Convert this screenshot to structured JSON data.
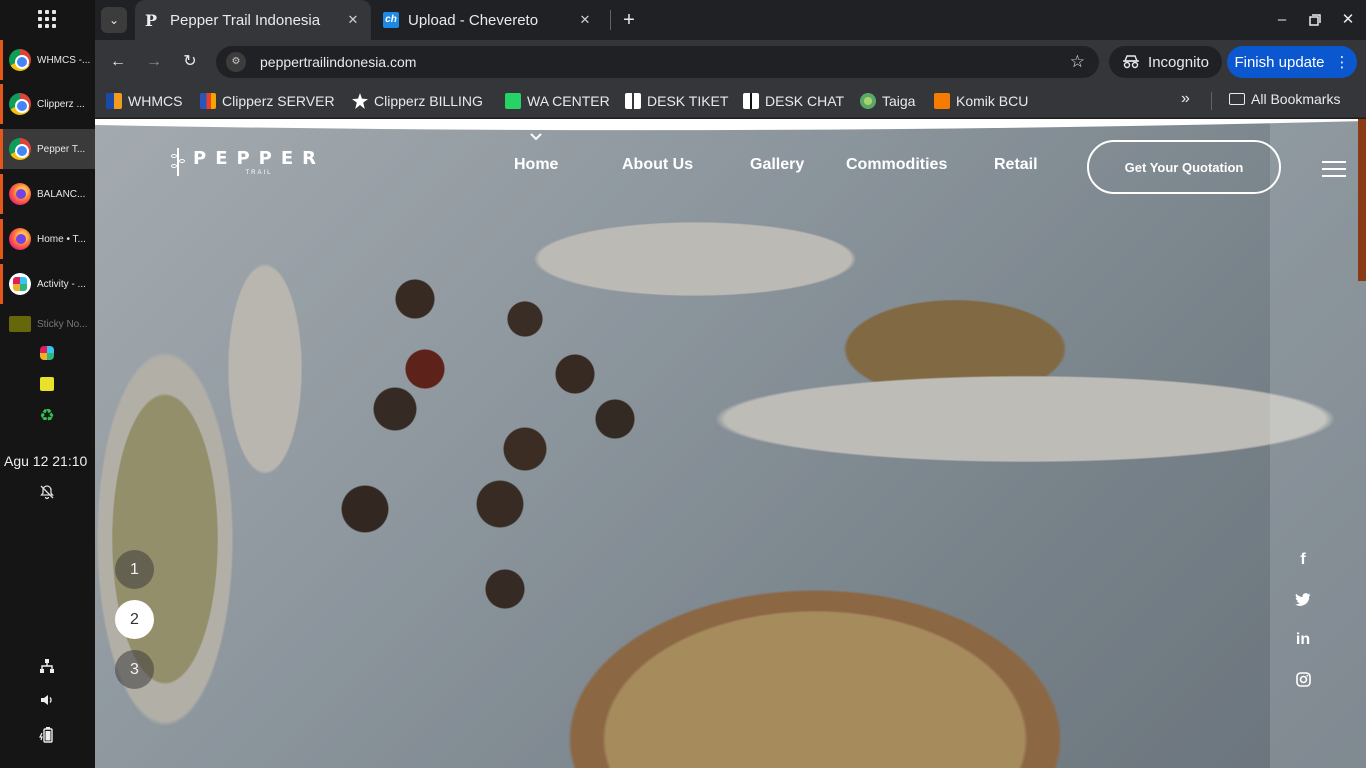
{
  "taskbar": {
    "items": [
      {
        "label": "WHMCS -...",
        "icon": "chrome-icon"
      },
      {
        "label": "Clipperz ...",
        "icon": "chrome-icon"
      },
      {
        "label": "Pepper T...",
        "icon": "chrome-icon",
        "active": true
      },
      {
        "label": "BALANC...",
        "icon": "firefox-icon"
      },
      {
        "label": "Home • T...",
        "icon": "firefox-icon"
      },
      {
        "label": "Activity - ...",
        "icon": "slack-icon"
      },
      {
        "label": "Sticky No...",
        "icon": "sticky-notes-icon"
      }
    ],
    "clock": "Agu 12  21:10"
  },
  "browser": {
    "tabs": [
      {
        "title": "Pepper Trail Indonesia",
        "favicon": "P",
        "active": true
      },
      {
        "title": "Upload - Chevereto",
        "favicon": "ch",
        "active": false
      }
    ],
    "url": "peppertrailindonesia.com",
    "incognito_label": "Incognito",
    "update_label": "Finish update",
    "bookmarks": [
      {
        "label": "WHMCS"
      },
      {
        "label": "Clipperz SERVER"
      },
      {
        "label": "Clipperz BILLING"
      },
      {
        "label": "WA CENTER"
      },
      {
        "label": "DESK TIKET"
      },
      {
        "label": "DESK CHAT"
      },
      {
        "label": "Taiga"
      },
      {
        "label": "Komik BCU"
      }
    ],
    "all_bookmarks_label": "All Bookmarks"
  },
  "site": {
    "logo_word": "PEPPER",
    "logo_sub": "TRAIL",
    "nav": [
      "Home",
      "About Us",
      "Gallery",
      "Commodities",
      "Retail"
    ],
    "cta": "Get Your Quotation",
    "slides": [
      "1",
      "2",
      "3"
    ],
    "active_slide": "2",
    "social": [
      "facebook",
      "twitter",
      "linkedin",
      "instagram"
    ],
    "social_glyphs": {
      "facebook": "f",
      "linkedin": "in"
    }
  },
  "colors": {
    "accent_orange": "#e4571b",
    "update_blue": "#0b57d0",
    "scroll_indicator": "#8a3b15"
  }
}
